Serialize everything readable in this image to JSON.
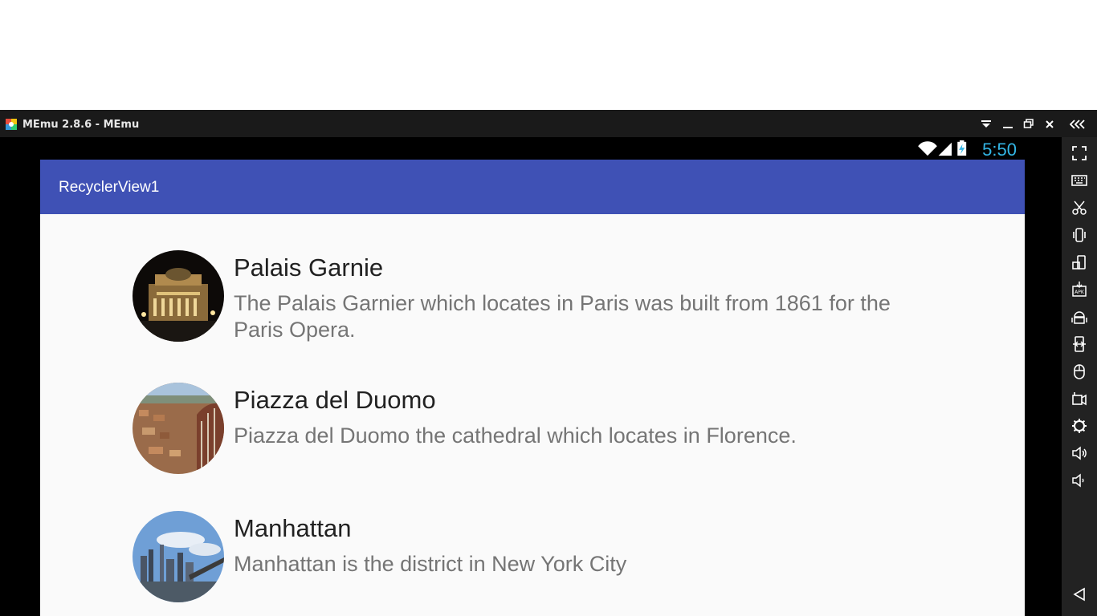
{
  "window": {
    "title": "MEmu 2.8.6 - MEmu",
    "controls": [
      "dropdown-icon",
      "minimize-icon",
      "restore-icon",
      "close-icon",
      "collapse-panel-icon"
    ]
  },
  "status_bar": {
    "time": "5:50",
    "icons": [
      "wifi-icon",
      "signal-icon",
      "battery-charging-icon"
    ],
    "time_color": "#33b5e5"
  },
  "app_bar": {
    "title": "RecyclerView1",
    "color": "#3f51b5"
  },
  "items": [
    {
      "title": "Palais Garnie",
      "description": "The Palais Garnier which locates in Paris was built from 1861 for the Paris Opera."
    },
    {
      "title": "Piazza del Duomo",
      "description": "Piazza del Duomo the cathedral which locates in Florence."
    },
    {
      "title": "Manhattan",
      "description": "Manhattan is the district in New York City"
    }
  ],
  "side_panel": {
    "icons": [
      "fullscreen-icon",
      "keyboard-icon",
      "scissors-icon",
      "shake-icon",
      "rotate-icon",
      "apk-install-icon",
      "android-icon",
      "phone-resize-icon",
      "mouse-icon",
      "record-icon",
      "settings-icon",
      "volume-up-icon",
      "volume-down-icon",
      "back-icon"
    ]
  }
}
